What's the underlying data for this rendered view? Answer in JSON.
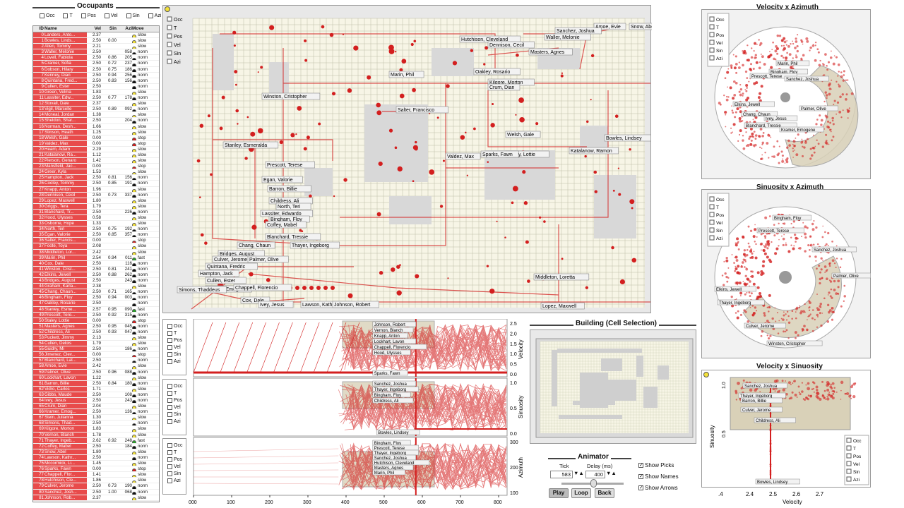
{
  "colors": {
    "accent": "#d31f1f",
    "selected": "#e84b4b",
    "panel": "#f4f4f4",
    "floor": "#f7f5e6"
  },
  "occupants": {
    "title": "Occupants",
    "filters": [
      "Occ",
      "T",
      "Pos",
      "Vel",
      "Sin",
      "Azi"
    ],
    "columns": [
      "ID",
      "Name",
      "Vel",
      "Sin",
      "Azi",
      "Move"
    ],
    "rows": [
      [
        "0",
        "Landers, Anto...",
        "2.37",
        "",
        "",
        "slow"
      ],
      [
        "1",
        "Bowles, Linds...",
        "2.50",
        "0.00",
        "",
        "slow"
      ],
      [
        "2",
        "Allen, Tommy",
        "2.21",
        "",
        "",
        "slow"
      ],
      [
        "3",
        "Waller, Melonie",
        "2.50",
        "",
        "058",
        "norm"
      ],
      [
        "4",
        "Lovell, Fabiola",
        "2.50",
        "0.86",
        "205",
        "norm"
      ],
      [
        "5",
        "Cramer, Sofia",
        "2.50",
        "0.72",
        "237",
        "norm"
      ],
      [
        "6",
        "Dobson, Hilary",
        "2.50",
        "0.75",
        "186",
        "norm"
      ],
      [
        "7",
        "Kenney, Dian",
        "2.50",
        "0.94",
        "256",
        "norm"
      ],
      [
        "8",
        "Quintana, Fred...",
        "2.50",
        "0.83",
        "156",
        "norm"
      ],
      [
        "9",
        "Cullen, Ester",
        "2.50",
        "",
        "",
        "norm"
      ],
      [
        "10",
        "Green, Velma",
        "1.83",
        "",
        "",
        "slow"
      ],
      [
        "11",
        "Lassiter, Edw...",
        "2.50",
        "0.77",
        "178",
        "norm"
      ],
      [
        "12",
        "Stovall, Dale",
        "2.37",
        "",
        "",
        "slow"
      ],
      [
        "13",
        "Vigil, Marcelle",
        "2.50",
        "0.89",
        "092",
        "norm"
      ],
      [
        "14",
        "Mcneal, Jordan",
        "1.38",
        "",
        "",
        "slow"
      ],
      [
        "15",
        "Sheldon, Shar...",
        "2.50",
        "",
        "204",
        "norm"
      ],
      [
        "16",
        "Norman, Desh...",
        "1.66",
        "",
        "",
        "slow"
      ],
      [
        "17",
        "Stinson, Heath",
        "1.25",
        "",
        "",
        "slow"
      ],
      [
        "18",
        "Welsh, Gale",
        "0.00",
        "",
        "",
        "stop"
      ],
      [
        "19",
        "Valdez, Max",
        "0.00",
        "",
        "",
        "stop"
      ],
      [
        "20",
        "Hearn, Adam",
        "2.29",
        "",
        "",
        "slow"
      ],
      [
        "21",
        "Katalanow, Ra...",
        "1.12",
        "",
        "",
        "slow"
      ],
      [
        "22",
        "Pierson, Genaro",
        "1.42",
        "",
        "",
        "slow"
      ],
      [
        "23",
        "Mansfield, Jac...",
        "0.00",
        "",
        "",
        "stop"
      ],
      [
        "24",
        "Greer, Kyla",
        "1.53",
        "",
        "",
        "slow"
      ],
      [
        "25",
        "Hampton, Jack",
        "2.50",
        "0.81",
        "156",
        "norm"
      ],
      [
        "26",
        "Cooley, Tommy",
        "2.50",
        "0.85",
        "191",
        "norm"
      ],
      [
        "27",
        "Knapp, Anton",
        "1.96",
        "",
        "",
        "slow"
      ],
      [
        "28",
        "Dennison, Cecil",
        "2.50",
        "0.73",
        "337",
        "norm"
      ],
      [
        "29",
        "Lopez, Maxwell",
        "1.80",
        "",
        "",
        "slow"
      ],
      [
        "30",
        "Griggs, Tera",
        "1.79",
        "",
        "",
        "slow"
      ],
      [
        "31",
        "Blanchard, Tr...",
        "2.50",
        "",
        "226",
        "norm"
      ],
      [
        "32",
        "Hood, Ulysses",
        "0.58",
        "",
        "",
        "slow"
      ],
      [
        "33",
        "Osborne, Hope",
        "1.33",
        "",
        "",
        "slow"
      ],
      [
        "34",
        "North, Teri",
        "2.50",
        "0.75",
        "192",
        "norm"
      ],
      [
        "35",
        "Egan, Valorie",
        "2.50",
        "0.85",
        "357",
        "norm"
      ],
      [
        "36",
        "Salter, Francis...",
        "0.00",
        "",
        "",
        "stop"
      ],
      [
        "37",
        "Foote, Toya",
        "2.08",
        "",
        "",
        "slow"
      ],
      [
        "38",
        "Middleton, Lor...",
        "2.42",
        "",
        "",
        "slow"
      ],
      [
        "39",
        "Marin, Phil",
        "2.54",
        "0.94",
        "011",
        "fast"
      ],
      [
        "40",
        "Cox, Dale",
        "2.50",
        "",
        "116",
        "norm"
      ],
      [
        "41",
        "Winston, Crist...",
        "2.50",
        "0.81",
        "241",
        "norm"
      ],
      [
        "42",
        "Elkins, Jewell",
        "2.50",
        "0.88",
        "262",
        "norm"
      ],
      [
        "43",
        "Bridges, August",
        "2.50",
        "",
        "243",
        "norm"
      ],
      [
        "44",
        "Graham, Karla...",
        "2.38",
        "",
        "",
        "slow"
      ],
      [
        "45",
        "Chang, Chaun...",
        "2.50",
        "0.71",
        "165",
        "norm"
      ],
      [
        "46",
        "Bingham, Floy",
        "2.50",
        "0.94",
        "003",
        "norm"
      ],
      [
        "47",
        "Oakley, Rosario",
        "2.50",
        "",
        "",
        "norm"
      ],
      [
        "48",
        "Stanley, Esme...",
        "2.57",
        "0.95",
        "090",
        "fast"
      ],
      [
        "49",
        "Prescott, Tere...",
        "2.50",
        "0.92",
        "315",
        "norm"
      ],
      [
        "50",
        "Staley, Lottie",
        "0.00",
        "",
        "",
        "stop"
      ],
      [
        "51",
        "Masters, Agnes",
        "2.50",
        "0.95",
        "045",
        "norm"
      ],
      [
        "52",
        "Childress, Ali",
        "2.50",
        "0.93",
        "047",
        "norm"
      ],
      [
        "53",
        "Puckett, Jimmy",
        "2.13",
        "",
        "",
        "slow"
      ],
      [
        "54",
        "Cullen, Delois",
        "1.79",
        "",
        "",
        "slow"
      ],
      [
        "55",
        "Guidry, Mi",
        "2.50",
        "",
        "186",
        "norm"
      ],
      [
        "56",
        "Jimenez, Clev...",
        "0.00",
        "",
        "",
        "stop"
      ],
      [
        "57",
        "Blanchard, Lat...",
        "2.50",
        "",
        "",
        "norm"
      ],
      [
        "58",
        "Amoe, Evie",
        "2.42",
        "",
        "",
        "slow"
      ],
      [
        "59",
        "Palmer, Olive",
        "2.50",
        "0.96",
        "088",
        "norm"
      ],
      [
        "60",
        "Lockhart, Lavon",
        "1.22",
        "",
        "",
        "slow"
      ],
      [
        "61",
        "Barron, Billie",
        "2.50",
        "0.84",
        "180",
        "norm"
      ],
      [
        "62",
        "Vidro, Carlos",
        "1.71",
        "",
        "",
        "slow"
      ],
      [
        "63",
        "Gibbs, Maude",
        "2.50",
        "",
        "108",
        "norm"
      ],
      [
        "64",
        "Ivey, Jesus",
        "2.50",
        "",
        "243",
        "norm"
      ],
      [
        "65",
        "Crum, Dian",
        "2.04",
        "",
        "",
        "slow"
      ],
      [
        "66",
        "Kramer, Emog...",
        "2.50",
        "",
        "136",
        "norm"
      ],
      [
        "67",
        "Stein, Julianna",
        "1.30",
        "",
        "",
        "slow"
      ],
      [
        "68",
        "Simons, Thad...",
        "2.50",
        "",
        "",
        "norm"
      ],
      [
        "69",
        "Kilgore, Morton",
        "1.83",
        "",
        "",
        "slow"
      ],
      [
        "70",
        "Vernon, Blanch",
        "1.78",
        "",
        "",
        "slow"
      ],
      [
        "71",
        "Thayer, Ingeb...",
        "2.62",
        "0.92",
        "248",
        "fast"
      ],
      [
        "72",
        "Coffey, Mabel",
        "2.50",
        "",
        "184",
        "norm"
      ],
      [
        "73",
        "Snow, Abel",
        "1.80",
        "",
        "",
        "slow"
      ],
      [
        "74",
        "Lawson, Kathr...",
        "2.50",
        "",
        "",
        "norm"
      ],
      [
        "75",
        "Mccormick, Li...",
        "1.45",
        "",
        "",
        "slow"
      ],
      [
        "76",
        "Sparks, Fawn",
        "0.00",
        "",
        "",
        "stop"
      ],
      [
        "77",
        "Chappell, Flor...",
        "1.41",
        "",
        "",
        "slow"
      ],
      [
        "78",
        "Hutchison, Cle...",
        "1.86",
        "",
        "",
        "slow"
      ],
      [
        "79",
        "Culver, Jerome",
        "2.50",
        "0.73",
        "190",
        "norm"
      ],
      [
        "80",
        "Sanchez, Josh...",
        "2.50",
        "1.00",
        "068",
        "norm"
      ],
      [
        "81",
        "Johnson, Rob...",
        "2.37",
        "",
        "",
        "slow"
      ]
    ]
  },
  "floor_labels": [
    "Amoe, Evie",
    "Snow, Abel",
    "Sanchez, Joshua",
    "Waller, Melonie",
    "Hutchison, Cleveland",
    "Dennison, Cecil",
    "Masters, Agnes",
    "Marin, Phil",
    "Oakley, Rosario",
    "Kilgore, Morton",
    "Crum, Dian",
    "Winston, Cristopher",
    "Salter, Francisco",
    "Welsh, Gale",
    "Bowles, Lindsey",
    "Stanley, Esmeralda",
    "Staley, Lottie",
    "Katalanow, Ramon",
    "Valdez, Max",
    "Sparks, Fawn",
    "Prescott, Terese",
    "Egan, Valorie",
    "Barron, Billie",
    "Childress, Ali",
    "North, Teri",
    "Lassiter, Edwardo",
    "Bingham, Floy",
    "Coffey, Mabel",
    "Blanchard, Tressie",
    "Chang, Chaun",
    "Thayer, Ingeborg",
    "Bridges, August",
    "Culver, Jerome",
    "Palmer, Olive",
    "Quintana, Fredric",
    "Hampton, Jack",
    "Cullen, Ester",
    "Kramer, Emogene",
    "Chappell, Florencio",
    "Simons, Thaddeus",
    "Cox, Dale",
    "Ivey, Jesus",
    "Lawson, Kathrine",
    "Johnson, Robert",
    "Middleton, Loretta",
    "Lopez, Maxwell"
  ],
  "timeline": {
    "filters": [
      "Occ",
      "T",
      "Pos",
      "Vel",
      "Sin",
      "Azi"
    ],
    "ylabels": [
      "Velocity",
      "Sinuosity",
      "Azimuth"
    ],
    "ticks_vel": [
      "2.5",
      "2.0",
      "1.5",
      "1.0",
      "0.5",
      "0.0"
    ],
    "ticks_sin": [
      "1.0",
      "0.5",
      "0.0"
    ],
    "ticks_azi": [
      "300",
      "200",
      "100"
    ],
    "xticks": [
      "000",
      "100",
      "200",
      "300",
      "400",
      "500",
      "600",
      "700",
      "800"
    ],
    "vel_labels": [
      "Johnson, Robert",
      "Vernon, Blanch",
      "Knapp, Anton",
      "Lockhart, Lavon",
      "Chappell, Florencio",
      "Hood, Ulysses",
      "Sparks, Fawn"
    ],
    "sin_labels": [
      "Sanchez, Joshua",
      "Thayer, Ingeborg",
      "Bingham, Floy",
      "Childress, Ali",
      "Bowles, Lindsey"
    ],
    "azi_labels": [
      "Bingham, Floy",
      "Prescott, Terese",
      "Thayer, Ingeborg",
      "Sanchez, Joshua",
      "Hutchison, Cleveland",
      "Masters, Agnes",
      "Marin, Phil"
    ]
  },
  "building": {
    "title": "Building (Cell Selection)"
  },
  "animator": {
    "title": "Animator",
    "tick_label": "Tick",
    "delay_label": "Delay (ms)",
    "tick_value": "583",
    "delay_value": "400",
    "play": "Play",
    "loop": "Loop",
    "back": "Back"
  },
  "show": {
    "picks": "Show Picks",
    "names": "Show Names",
    "arrows": "Show Arrows"
  },
  "polar1": {
    "title": "Velocity x Azimuth",
    "labels": [
      "Marin, Phil",
      "Bingham, Floy",
      "Prescott, Terese",
      "Sanchez, Joshua",
      "Elkins, Jewell",
      "Palmer, Olive",
      "Chang, Chaun",
      "Ivey, Jesus",
      "Blanchard, Tressie",
      "Kramer, Emogene"
    ]
  },
  "polar2": {
    "title": "Sinuosity x Azimuth",
    "labels": [
      "Bingham, Floy",
      "Prescott, Terese",
      "Sanchez, Joshua",
      "Elkins, Jewell",
      "Palmer, Olive",
      "Thayer, Ingeborg",
      "Culver, Jerome",
      "Winston, Cristopher"
    ]
  },
  "scatter": {
    "title": "Velocity x Sinuosity",
    "xlabel": "Velocity",
    "ylabel": "Sinuosity",
    "xticks": [
      "2.4",
      "2.5",
      "2.6",
      "2.7"
    ],
    "yticks": [
      "1.0",
      "0.5"
    ],
    "labels": [
      "Sanchez, Joshua",
      "Thayer, Ingeborg",
      "Barron, Billie",
      "Culver, Jerome",
      "Childress, Ali",
      "Bowles, Lindsey"
    ],
    "filters": [
      "Occ",
      "T",
      "Pos",
      "Vel",
      "Sin",
      "Azi"
    ]
  }
}
